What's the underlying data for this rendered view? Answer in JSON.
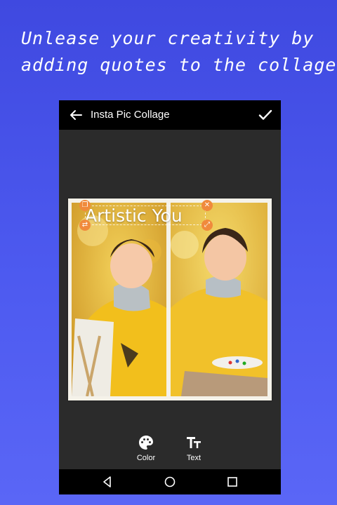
{
  "promo": {
    "line1": "Unlease your creativity by",
    "line2": "adding quotes to the collage"
  },
  "app": {
    "title": "Insta Pic Collage",
    "icons": {
      "back": "arrow-left-icon",
      "confirm": "check-icon"
    }
  },
  "collage": {
    "sticker_text": "Artistic You",
    "handle_icons": [
      "copy-icon",
      "close-icon",
      "flip-icon",
      "resize-icon"
    ]
  },
  "toolbar": {
    "tools": [
      {
        "label": "Color",
        "icon": "palette-icon"
      },
      {
        "label": "Text",
        "icon": "text-format-icon"
      }
    ]
  },
  "navbar": {
    "icons": [
      "back-triangle-icon",
      "home-circle-icon",
      "recents-square-icon"
    ]
  },
  "colors": {
    "background": "#4652e8",
    "accent": "#f08a3c",
    "appbar": "#000000",
    "workspace": "#2b2b2b"
  }
}
